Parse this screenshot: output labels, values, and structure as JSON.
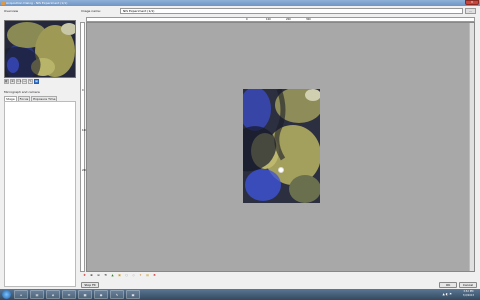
{
  "window": {
    "title": "Acquisition Dialog - NIS Experiment (1/1)",
    "close_label": "✕"
  },
  "left_panel": {
    "overview_label": "Overview",
    "tool_buttons": [
      "◧",
      "⊕",
      "1:1",
      "↔",
      "✎",
      "⊞"
    ],
    "settings_label": "Micrograph and camera",
    "tabs": [
      "Stage",
      "Focus",
      "Exposure Time"
    ]
  },
  "main": {
    "name_label": "Image name:",
    "name_value": "NIS Experiment (1/1)",
    "browse_label": "...",
    "ruler_h_ticks": [
      "0",
      "100",
      "200",
      "300"
    ],
    "ruler_v_ticks": [
      "0",
      "100",
      "200"
    ],
    "bottom_tools": [
      "✚",
      "⊕",
      "⊖",
      "⟲",
      "▲",
      "▣",
      "○",
      "◇",
      "✦",
      "▤",
      "✖"
    ]
  },
  "buttons": {
    "stop": "Stop Fit",
    "ok": "OK",
    "cancel": "Cancel"
  },
  "taskbar": {
    "apps": [
      "e",
      "▤",
      "◈",
      "✉",
      "▦",
      "◉",
      "✎",
      "▣"
    ],
    "time": "3:52 PM",
    "date": "7/2/2013",
    "tray_icons": "▲ ◐ ⚑"
  },
  "colors": {
    "canvas": "#a8a8a8",
    "window_bg": "#f0f0f0",
    "taskbar": "#33495f",
    "active_tool": "#3a7bd5"
  }
}
